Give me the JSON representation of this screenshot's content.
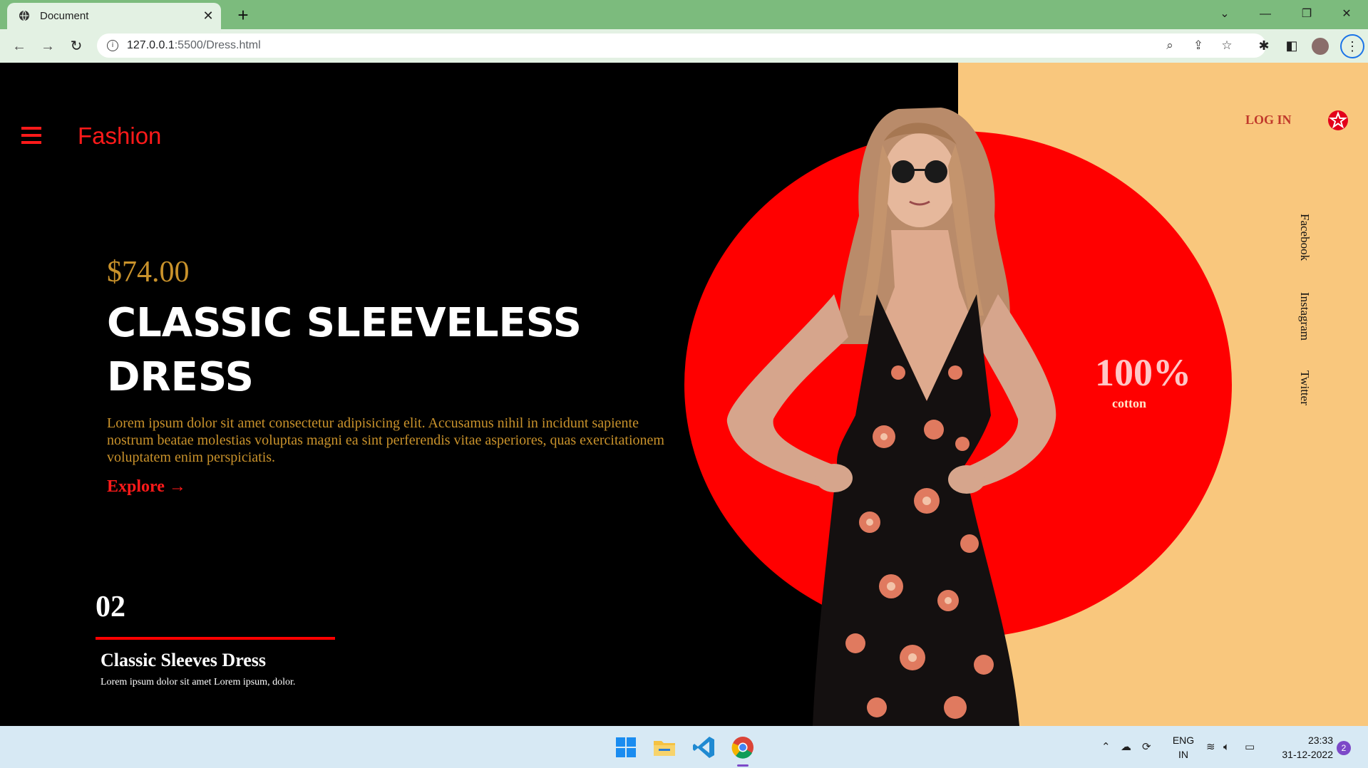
{
  "browser": {
    "tab_title": "Document",
    "tab_close": "✕",
    "new_tab": "+",
    "url_host": "127.0.0.1",
    "url_rest": ":5500/Dress.html",
    "icons": [
      "back-icon",
      "forward-icon",
      "reload-icon",
      "info-icon",
      "zoom-icon",
      "share-icon",
      "star-icon",
      "extensions-icon",
      "sidepanel-icon",
      "profile-avatar",
      "menu-icon"
    ]
  },
  "page": {
    "brand": "Fashion",
    "price": "$74.00",
    "headline": "CLASSIC SLEEVELESS DRESS",
    "description": "Lorem ipsum dolor sit amet consectetur adipisicing elit. Accusamus nihil in incidunt sapiente nostrum beatae molestias voluptas magni ea sint perferendis vitae asperiores, quas exercitationem voluptatem enim perspiciatis.",
    "explore": "Explore →",
    "card": {
      "number": "02",
      "title": "Classic Sleeves Dress",
      "text": "Lorem ipsum dolor sit amet Lorem ipsum, dolor."
    },
    "login": "LOG IN",
    "social": [
      "Facebook",
      "Instagram",
      "Twitter"
    ],
    "cotton_pct": "100%",
    "cotton_label": "cotton",
    "colors": {
      "accent_red": "#ff0000",
      "panel_peach": "#f9c77d",
      "gold_text": "#c9922b",
      "background": "#000000"
    }
  },
  "taskbar": {
    "lang_top": "ENG",
    "lang_bottom": "IN",
    "time": "23:33",
    "date": "31-12-2022",
    "notifications": "2"
  }
}
